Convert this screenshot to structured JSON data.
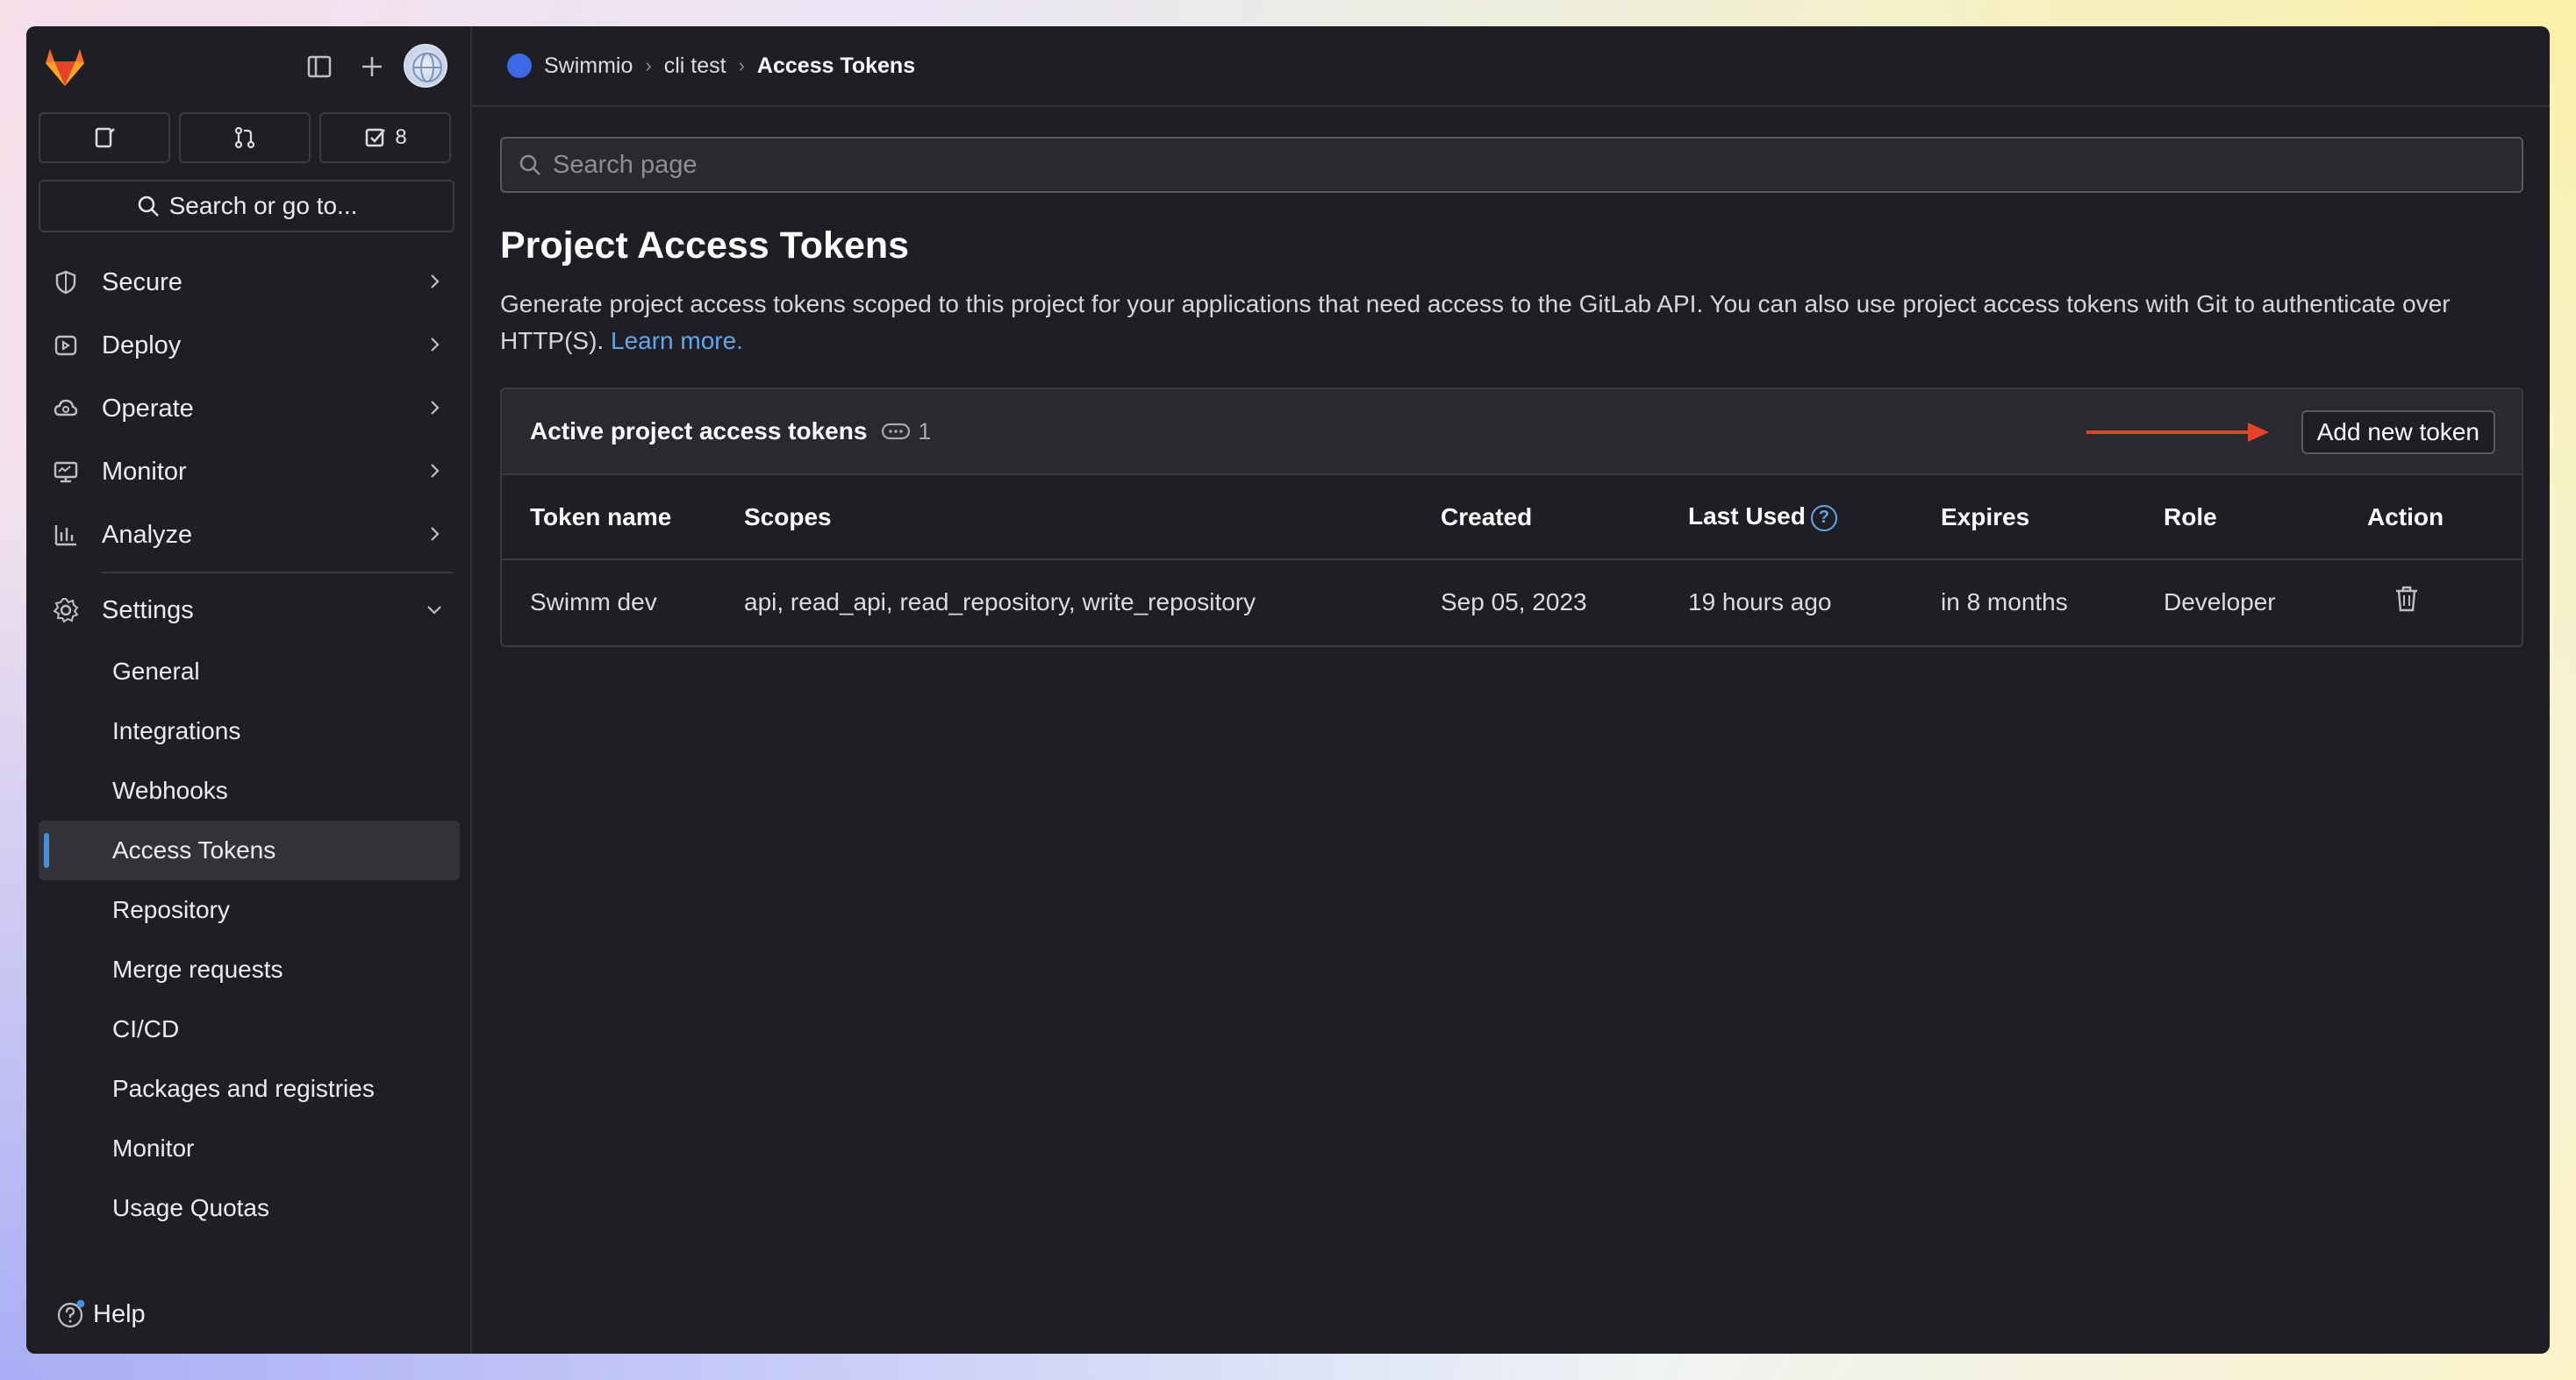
{
  "sidebar": {
    "todo_count": "8",
    "search_label": "Search or go to...",
    "nav": [
      {
        "label": "Secure",
        "icon": "shield-icon"
      },
      {
        "label": "Deploy",
        "icon": "deploy-icon"
      },
      {
        "label": "Operate",
        "icon": "cloud-icon"
      },
      {
        "label": "Monitor",
        "icon": "monitor-icon"
      },
      {
        "label": "Analyze",
        "icon": "chart-icon"
      }
    ],
    "settings_label": "Settings",
    "settings_items": [
      {
        "label": "General"
      },
      {
        "label": "Integrations"
      },
      {
        "label": "Webhooks"
      },
      {
        "label": "Access Tokens"
      },
      {
        "label": "Repository"
      },
      {
        "label": "Merge requests"
      },
      {
        "label": "CI/CD"
      },
      {
        "label": "Packages and registries"
      },
      {
        "label": "Monitor"
      },
      {
        "label": "Usage Quotas"
      }
    ],
    "help_label": "Help"
  },
  "breadcrumb": {
    "items": [
      "Swimmio",
      "cli test",
      "Access Tokens"
    ]
  },
  "search_page": {
    "placeholder": "Search page"
  },
  "page": {
    "title": "Project Access Tokens",
    "description": "Generate project access tokens scoped to this project for your applications that need access to the GitLab API. You can also use project access tokens with Git to authenticate over HTTP(S).",
    "learn_more": "Learn more."
  },
  "tokens_card": {
    "title": "Active project access tokens",
    "count": "1",
    "add_button": "Add new token",
    "columns": [
      "Token name",
      "Scopes",
      "Created",
      "Last Used",
      "Expires",
      "Role",
      "Action"
    ],
    "rows": [
      {
        "name": "Swimm dev",
        "scopes": "api, read_api, read_repository, write_repository",
        "created": "Sep 05, 2023",
        "last_used": "19 hours ago",
        "expires": "in 8 months",
        "role": "Developer"
      }
    ]
  },
  "colors": {
    "accent": "#428fdc",
    "link": "#63a6e9",
    "arrow": "#e24329",
    "background": "#1f1e24"
  }
}
